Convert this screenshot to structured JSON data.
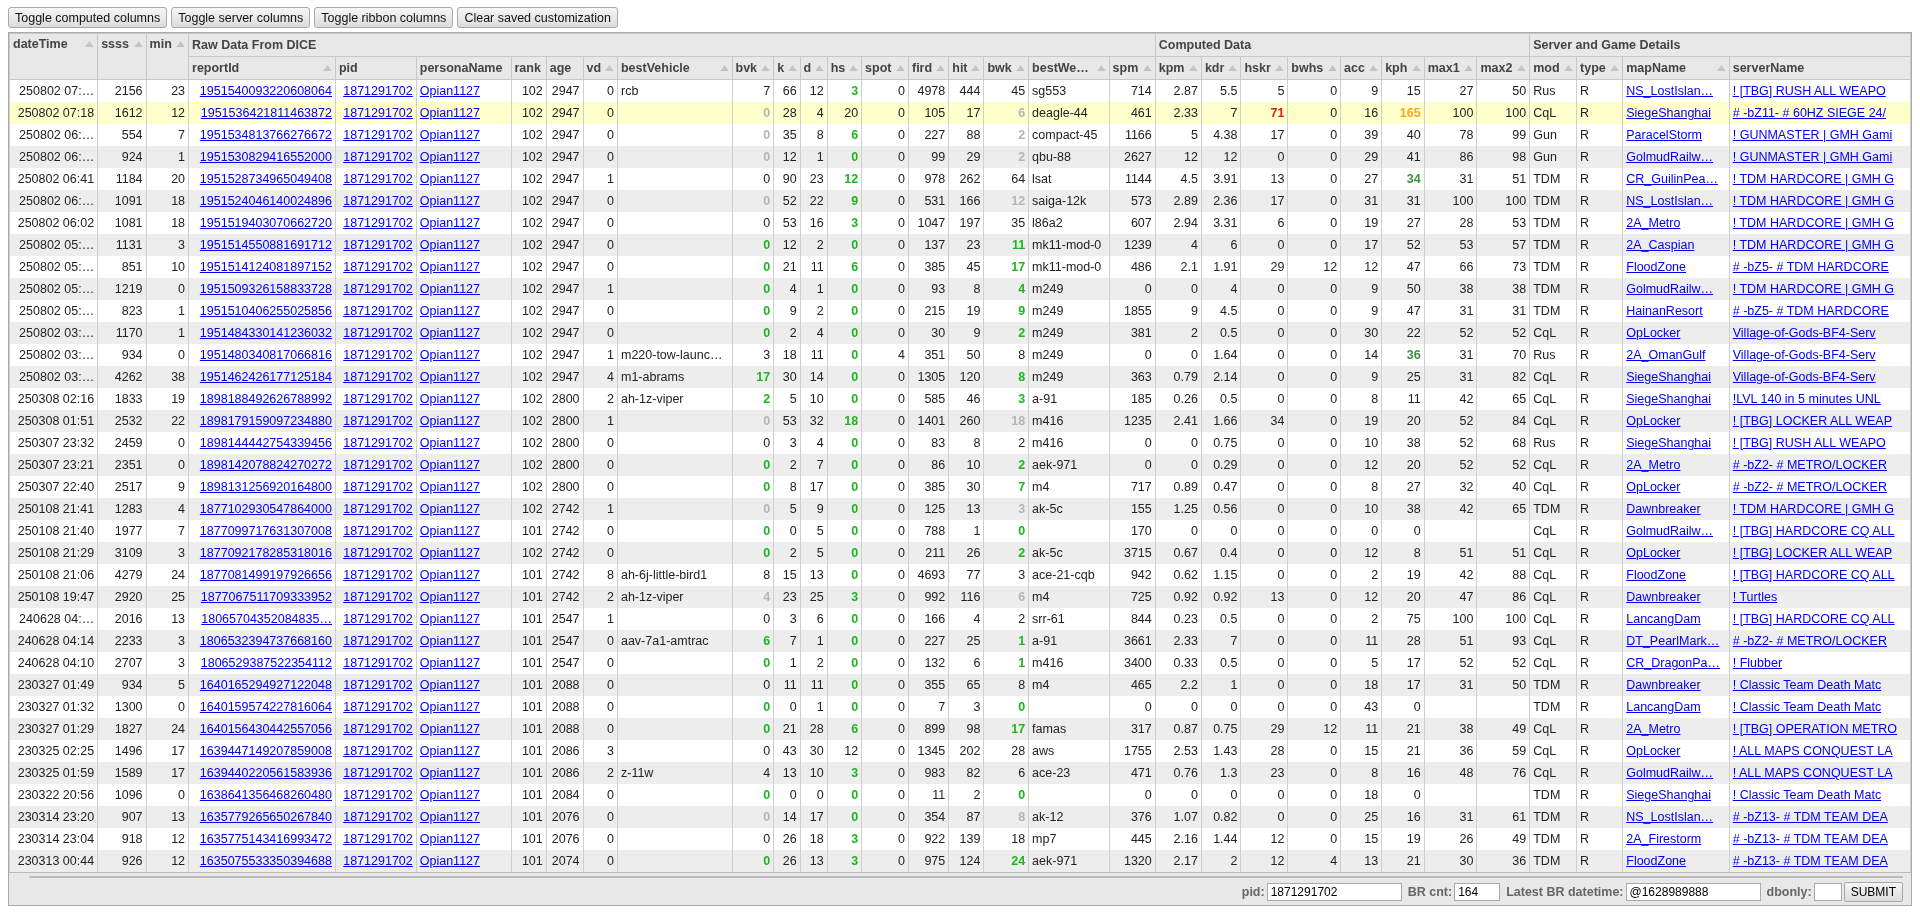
{
  "toolbar": {
    "buttons": [
      "Toggle computed columns",
      "Toggle server columns",
      "Toggle ribbon columns",
      "Clear saved customization"
    ]
  },
  "table": {
    "header": [
      {
        "label": "dateTime",
        "kind": "number",
        "sortable": true
      },
      {
        "label": "ssss",
        "kind": "number",
        "sortable": true
      },
      {
        "label": "min",
        "kind": "number",
        "sortable": true
      },
      {
        "kind": "group",
        "label": "Raw Data From DICE",
        "columns": [
          {
            "label": "reportId",
            "kind": "link-number",
            "sortable": true
          },
          {
            "label": "pid",
            "kind": "link-number",
            "sortable": false
          },
          {
            "label": "personaName",
            "kind": "link",
            "sortable": false
          },
          {
            "label": "rank",
            "kind": "number",
            "sortable": false
          },
          {
            "label": "age",
            "kind": "number",
            "sortable": false
          },
          {
            "label": "vd",
            "kind": "number",
            "sortable": true
          },
          {
            "label": "bestVehicle",
            "kind": "text",
            "sortable": true
          },
          {
            "label": "bvk",
            "kind": "number",
            "sortable": true
          },
          {
            "label": "k",
            "kind": "number",
            "sortable": true
          },
          {
            "label": "d",
            "kind": "number",
            "sortable": true
          },
          {
            "label": "hs",
            "kind": "number",
            "sortable": true
          },
          {
            "label": "spot",
            "kind": "number",
            "sortable": true
          },
          {
            "label": "fird",
            "kind": "number",
            "sortable": true
          },
          {
            "label": "hit",
            "kind": "number",
            "sortable": true
          },
          {
            "label": "bwk",
            "kind": "number",
            "sortable": true
          },
          {
            "label": "bestWe…",
            "kind": "text",
            "sortable": true
          },
          {
            "label": "spm",
            "kind": "number",
            "sortable": true
          }
        ]
      },
      {
        "kind": "group",
        "label": "Computed Data",
        "columns": [
          {
            "label": "kpm",
            "kind": "number",
            "sortable": true
          },
          {
            "label": "kdr",
            "kind": "number",
            "sortable": true
          },
          {
            "label": "hskr",
            "kind": "number",
            "sortable": true
          },
          {
            "label": "bwhs",
            "kind": "number",
            "sortable": true
          },
          {
            "label": "acc",
            "kind": "number",
            "sortable": true
          },
          {
            "label": "kph",
            "kind": "number",
            "sortable": true
          },
          {
            "label": "max1",
            "kind": "number",
            "sortable": true
          },
          {
            "label": "max2",
            "kind": "number",
            "sortable": true
          }
        ]
      },
      {
        "kind": "group",
        "label": "Server and Game Details",
        "columns": [
          {
            "label": "mod",
            "kind": "text",
            "sortable": true
          },
          {
            "label": "type",
            "kind": "text",
            "sortable": true
          },
          {
            "label": "mapName",
            "kind": "link",
            "sortable": true
          },
          {
            "label": "serverName",
            "kind": "link",
            "sortable": false
          }
        ]
      }
    ],
    "rows": [
      {
        "selected": false,
        "cells": [
          "250802 07:…",
          "2156",
          "23",
          "1951540093220608064",
          "1871291702",
          "Opian1127",
          "102",
          "2947",
          "0",
          "rcb",
          "7",
          "66",
          "12",
          {
            "text": "3",
            "color": "#1fb51f"
          },
          "0",
          "4978",
          "444",
          "45",
          "sg553",
          "714",
          "2.87",
          "5.5",
          "5",
          "0",
          "9",
          "15",
          "27",
          "50",
          "Rus",
          "R",
          "NS_LostIslan…",
          "! [TBG] RUSH ALL WEAPO"
        ]
      },
      {
        "selected": true,
        "cells": [
          "250802 07:18",
          "1612",
          "12",
          "1951536421811463872",
          "1871291702",
          "Opian1127",
          "102",
          "2947",
          "0",
          null,
          {
            "text": "0",
            "color": "#b4b4b4"
          },
          "28",
          "4",
          "20",
          "0",
          "105",
          "17",
          {
            "text": "6",
            "color": "#b4b4b4"
          },
          "deagle-44",
          "461",
          "2.33",
          "7",
          {
            "text": "71",
            "color": "#e01b1b"
          },
          "0",
          "16",
          {
            "text": "165",
            "color": "#f5a623"
          },
          "100",
          "100",
          "CqL",
          "R",
          "SiegeShanghai",
          "# -bZ11- # 60HZ SIEGE 24/"
        ]
      },
      {
        "selected": false,
        "cells": [
          "250802 06:…",
          "554",
          "7",
          "1951534813766276672",
          "1871291702",
          "Opian1127",
          "102",
          "2947",
          "0",
          null,
          {
            "text": "0",
            "color": "#b4b4b4"
          },
          "35",
          "8",
          {
            "text": "6",
            "color": "#1fb51f"
          },
          "0",
          "227",
          "88",
          {
            "text": "2",
            "color": "#b4b4b4"
          },
          "compact-45",
          "1166",
          "5",
          "4.38",
          "17",
          "0",
          "39",
          "40",
          "78",
          "99",
          "Gun",
          "R",
          "ParacelStorm",
          "! GUNMASTER | GMH Gami"
        ]
      },
      {
        "selected": false,
        "cells": [
          "250802 06:…",
          "924",
          "1",
          "1951530829416552000",
          "1871291702",
          "Opian1127",
          "102",
          "2947",
          "0",
          null,
          {
            "text": "0",
            "color": "#b4b4b4"
          },
          "12",
          "1",
          {
            "text": "0",
            "color": "#1fb51f"
          },
          "0",
          "99",
          "29",
          {
            "text": "2",
            "color": "#b4b4b4"
          },
          "qbu-88",
          "2627",
          "12",
          "12",
          "0",
          "0",
          "29",
          "41",
          "86",
          "98",
          "Gun",
          "R",
          "GolmudRailw…",
          "! GUNMASTER | GMH Gami"
        ]
      },
      {
        "selected": false,
        "cells": [
          "250802 06:41",
          "1184",
          "20",
          "1951528734965049408",
          "1871291702",
          "Opian1127",
          "102",
          "2947",
          "1",
          null,
          "0",
          "90",
          "23",
          {
            "text": "12",
            "color": "#1fb51f"
          },
          "0",
          "978",
          "262",
          "64",
          "lsat",
          "1144",
          "4.5",
          "3.91",
          "13",
          "0",
          "27",
          {
            "text": "34",
            "color": "#3f8f3f"
          },
          "31",
          "51",
          "TDM",
          "R",
          "CR_GuilinPea…",
          "! TDM HARDCORE | GMH G"
        ]
      },
      {
        "selected": false,
        "cells": [
          "250802 06:…",
          "1091",
          "18",
          "1951524046140024896",
          "1871291702",
          "Opian1127",
          "102",
          "2947",
          "0",
          null,
          {
            "text": "0",
            "color": "#b4b4b4"
          },
          "52",
          "22",
          {
            "text": "9",
            "color": "#1fb51f"
          },
          "0",
          "531",
          "166",
          {
            "text": "12",
            "color": "#b4b4b4"
          },
          "saiga-12k",
          "573",
          "2.89",
          "2.36",
          "17",
          "0",
          "31",
          "31",
          "100",
          "100",
          "TDM",
          "R",
          "NS_LostIslan…",
          "! TDM HARDCORE | GMH G"
        ]
      },
      {
        "selected": false,
        "cells": [
          "250802 06:02",
          "1081",
          "18",
          "1951519403070662720",
          "1871291702",
          "Opian1127",
          "102",
          "2947",
          "0",
          null,
          "0",
          "53",
          "16",
          {
            "text": "3",
            "color": "#1fb51f"
          },
          "0",
          "1047",
          "197",
          "35",
          "l86a2",
          "607",
          "2.94",
          "3.31",
          "6",
          "0",
          "19",
          "27",
          "28",
          "53",
          "TDM",
          "R",
          "2A_Metro",
          "! TDM HARDCORE | GMH G"
        ]
      },
      {
        "selected": false,
        "cells": [
          "250802 05:…",
          "1131",
          "3",
          "1951514550881691712",
          "1871291702",
          "Opian1127",
          "102",
          "2947",
          "0",
          null,
          {
            "text": "0",
            "color": "#1fb51f"
          },
          "12",
          "2",
          {
            "text": "0",
            "color": "#1fb51f"
          },
          "0",
          "137",
          "23",
          {
            "text": "11",
            "color": "#1fb51f"
          },
          "mk11-mod-0",
          "1239",
          "4",
          "6",
          "0",
          "0",
          "17",
          "52",
          "53",
          "57",
          "TDM",
          "R",
          "2A_Caspian",
          "! TDM HARDCORE | GMH G"
        ]
      },
      {
        "selected": false,
        "cells": [
          "250802 05:…",
          "851",
          "10",
          "1951514124081897152",
          "1871291702",
          "Opian1127",
          "102",
          "2947",
          "0",
          null,
          {
            "text": "0",
            "color": "#1fb51f"
          },
          "21",
          "11",
          {
            "text": "6",
            "color": "#1fb51f"
          },
          "0",
          "385",
          "45",
          {
            "text": "17",
            "color": "#1fb51f"
          },
          "mk11-mod-0",
          "486",
          "2.1",
          "1.91",
          "29",
          "12",
          "12",
          "47",
          "66",
          "73",
          "TDM",
          "R",
          "FloodZone",
          "# -bZ5- # TDM HARDCORE"
        ]
      },
      {
        "selected": false,
        "cells": [
          "250802 05:…",
          "1219",
          "0",
          "1951509326158833728",
          "1871291702",
          "Opian1127",
          "102",
          "2947",
          "1",
          null,
          {
            "text": "0",
            "color": "#1fb51f"
          },
          "4",
          "1",
          {
            "text": "0",
            "color": "#1fb51f"
          },
          "0",
          "93",
          "8",
          {
            "text": "4",
            "color": "#1fb51f"
          },
          "m249",
          "0",
          "0",
          "4",
          "0",
          "0",
          "9",
          "50",
          "38",
          "38",
          "TDM",
          "R",
          "GolmudRailw…",
          "! TDM HARDCORE | GMH G"
        ]
      },
      {
        "selected": false,
        "cells": [
          "250802 05:…",
          "823",
          "1",
          "1951510406255025856",
          "1871291702",
          "Opian1127",
          "102",
          "2947",
          "0",
          null,
          {
            "text": "0",
            "color": "#1fb51f"
          },
          "9",
          "2",
          {
            "text": "0",
            "color": "#1fb51f"
          },
          "0",
          "215",
          "19",
          {
            "text": "9",
            "color": "#1fb51f"
          },
          "m249",
          "1855",
          "9",
          "4.5",
          "0",
          "0",
          "9",
          "47",
          "31",
          "31",
          "TDM",
          "R",
          "HainanResort",
          "# -bZ5- # TDM HARDCORE"
        ]
      },
      {
        "selected": false,
        "cells": [
          "250802 03:…",
          "1170",
          "1",
          "1951484330141236032",
          "1871291702",
          "Opian1127",
          "102",
          "2947",
          "0",
          null,
          {
            "text": "0",
            "color": "#1fb51f"
          },
          "2",
          "4",
          {
            "text": "0",
            "color": "#1fb51f"
          },
          "0",
          "30",
          "9",
          {
            "text": "2",
            "color": "#1fb51f"
          },
          "m249",
          "381",
          "2",
          "0.5",
          "0",
          "0",
          "30",
          "22",
          "52",
          "52",
          "CqL",
          "R",
          "OpLocker",
          "Village-of-Gods-BF4-Serv"
        ]
      },
      {
        "selected": false,
        "cells": [
          "250802 03:…",
          "934",
          "0",
          "1951480340817066816",
          "1871291702",
          "Opian1127",
          "102",
          "2947",
          "1",
          "m220-tow-launc…",
          "3",
          "18",
          "11",
          {
            "text": "0",
            "color": "#1fb51f"
          },
          "4",
          "351",
          "50",
          "8",
          "m249",
          "0",
          "0",
          "1.64",
          "0",
          "0",
          "14",
          {
            "text": "36",
            "color": "#3f8f3f"
          },
          "31",
          "70",
          "Rus",
          "R",
          "2A_OmanGulf",
          "Village-of-Gods-BF4-Serv"
        ]
      },
      {
        "selected": false,
        "cells": [
          "250802 03:…",
          "4262",
          "38",
          "1951462426177125184",
          "1871291702",
          "Opian1127",
          "102",
          "2947",
          "4",
          "m1-abrams",
          {
            "text": "17",
            "color": "#1fb51f"
          },
          "30",
          "14",
          {
            "text": "0",
            "color": "#1fb51f"
          },
          "0",
          "1305",
          "120",
          {
            "text": "8",
            "color": "#1fb51f"
          },
          "m249",
          "363",
          "0.79",
          "2.14",
          "0",
          "0",
          "9",
          "25",
          "31",
          "82",
          "CqL",
          "R",
          "SiegeShanghai",
          "Village-of-Gods-BF4-Serv"
        ]
      },
      {
        "selected": false,
        "cells": [
          "250308 02:16",
          "1833",
          "19",
          "1898188492626788992",
          "1871291702",
          "Opian1127",
          "102",
          "2800",
          "2",
          "ah-1z-viper",
          {
            "text": "2",
            "color": "#1fb51f"
          },
          "5",
          "10",
          {
            "text": "0",
            "color": "#1fb51f"
          },
          "0",
          "585",
          "46",
          {
            "text": "3",
            "color": "#1fb51f"
          },
          "a-91",
          "185",
          "0.26",
          "0.5",
          "0",
          "0",
          "8",
          "11",
          "42",
          "65",
          "CqL",
          "R",
          "SiegeShanghai",
          "!LVL 140 in 5 minutes UNL"
        ]
      },
      {
        "selected": false,
        "cells": [
          "250308 01:51",
          "2532",
          "22",
          "1898179159097234880",
          "1871291702",
          "Opian1127",
          "102",
          "2800",
          "1",
          null,
          {
            "text": "0",
            "color": "#b4b4b4"
          },
          "53",
          "32",
          {
            "text": "18",
            "color": "#1fb51f"
          },
          "0",
          "1401",
          "260",
          {
            "text": "18",
            "color": "#b4b4b4"
          },
          "m416",
          "1235",
          "2.41",
          "1.66",
          "34",
          "0",
          "19",
          "20",
          "52",
          "84",
          "CqL",
          "R",
          "OpLocker",
          "! [TBG] LOCKER ALL WEAP"
        ]
      },
      {
        "selected": false,
        "cells": [
          "250307 23:32",
          "2459",
          "0",
          "1898144442754339456",
          "1871291702",
          "Opian1127",
          "102",
          "2800",
          "0",
          null,
          "0",
          "3",
          "4",
          {
            "text": "0",
            "color": "#1fb51f"
          },
          "0",
          "83",
          "8",
          "2",
          "m416",
          "0",
          "0",
          "0.75",
          "0",
          "0",
          "10",
          "38",
          "52",
          "68",
          "Rus",
          "R",
          "SiegeShanghai",
          "! [TBG] RUSH ALL WEAPO"
        ]
      },
      {
        "selected": false,
        "cells": [
          "250307 23:21",
          "2351",
          "0",
          "1898142078824270272",
          "1871291702",
          "Opian1127",
          "102",
          "2800",
          "0",
          null,
          {
            "text": "0",
            "color": "#1fb51f"
          },
          "2",
          "7",
          {
            "text": "0",
            "color": "#1fb51f"
          },
          "0",
          "86",
          "10",
          {
            "text": "2",
            "color": "#1fb51f"
          },
          "aek-971",
          "0",
          "0",
          "0.29",
          "0",
          "0",
          "12",
          "20",
          "52",
          "52",
          "CqL",
          "R",
          "2A_Metro",
          "# -bZ2- # METRO/LOCKER"
        ]
      },
      {
        "selected": false,
        "cells": [
          "250307 22:40",
          "2517",
          "9",
          "1898131256920164800",
          "1871291702",
          "Opian1127",
          "102",
          "2800",
          "0",
          null,
          {
            "text": "0",
            "color": "#1fb51f"
          },
          "8",
          "17",
          {
            "text": "0",
            "color": "#1fb51f"
          },
          "0",
          "385",
          "30",
          {
            "text": "7",
            "color": "#1fb51f"
          },
          "m4",
          "717",
          "0.89",
          "0.47",
          "0",
          "0",
          "8",
          "27",
          "32",
          "40",
          "CqL",
          "R",
          "OpLocker",
          "# -bZ2- # METRO/LOCKER"
        ]
      },
      {
        "selected": false,
        "cells": [
          "250108 21:41",
          "1283",
          "4",
          "1877102930547864000",
          "1871291702",
          "Opian1127",
          "102",
          "2742",
          "1",
          null,
          {
            "text": "0",
            "color": "#b4b4b4"
          },
          "5",
          "9",
          {
            "text": "0",
            "color": "#1fb51f"
          },
          "0",
          "125",
          "13",
          {
            "text": "3",
            "color": "#b4b4b4"
          },
          "ak-5c",
          "155",
          "1.25",
          "0.56",
          "0",
          "0",
          "10",
          "38",
          "42",
          "65",
          "TDM",
          "R",
          "Dawnbreaker",
          "! TDM HARDCORE | GMH G"
        ]
      },
      {
        "selected": false,
        "cells": [
          "250108 21:40",
          "1977",
          "7",
          "1877099717631307008",
          "1871291702",
          "Opian1127",
          "101",
          "2742",
          "0",
          null,
          {
            "text": "0",
            "color": "#1fb51f"
          },
          "0",
          "5",
          {
            "text": "0",
            "color": "#1fb51f"
          },
          "0",
          "788",
          "1",
          {
            "text": "0",
            "color": "#1fb51f"
          },
          null,
          "170",
          "0",
          "0",
          "0",
          "0",
          "0",
          "0",
          null,
          null,
          "CqL",
          "R",
          "GolmudRailw…",
          "! [TBG] HARDCORE CQ ALL"
        ]
      },
      {
        "selected": false,
        "cells": [
          "250108 21:29",
          "3109",
          "3",
          "1877092178285318016",
          "1871291702",
          "Opian1127",
          "102",
          "2742",
          "0",
          null,
          {
            "text": "0",
            "color": "#1fb51f"
          },
          "2",
          "5",
          {
            "text": "0",
            "color": "#1fb51f"
          },
          "0",
          "211",
          "26",
          {
            "text": "2",
            "color": "#1fb51f"
          },
          "ak-5c",
          "3715",
          "0.67",
          "0.4",
          "0",
          "0",
          "12",
          "8",
          "51",
          "51",
          "CqL",
          "R",
          "OpLocker",
          "! [TBG] LOCKER ALL WEAP"
        ]
      },
      {
        "selected": false,
        "cells": [
          "250108 21:06",
          "4279",
          "24",
          "1877081499197926656",
          "1871291702",
          "Opian1127",
          "101",
          "2742",
          "8",
          "ah-6j-little-bird1",
          "8",
          "15",
          "13",
          {
            "text": "0",
            "color": "#1fb51f"
          },
          "0",
          "4693",
          "77",
          "3",
          "ace-21-cqb",
          "942",
          "0.62",
          "1.15",
          "0",
          "0",
          "2",
          "19",
          "42",
          "88",
          "CqL",
          "R",
          "FloodZone",
          "! [TBG] HARDCORE CQ ALL"
        ]
      },
      {
        "selected": false,
        "cells": [
          "250108 19:47",
          "2920",
          "25",
          "1877067511709333952",
          "1871291702",
          "Opian1127",
          "101",
          "2742",
          "2",
          "ah-1z-viper",
          {
            "text": "4",
            "color": "#b4b4b4"
          },
          "23",
          "25",
          {
            "text": "3",
            "color": "#1fb51f"
          },
          "0",
          "992",
          "116",
          {
            "text": "6",
            "color": "#b4b4b4"
          },
          "m4",
          "725",
          "0.92",
          "0.92",
          "13",
          "0",
          "12",
          "20",
          "47",
          "86",
          "CqL",
          "R",
          "Dawnbreaker",
          "! Turtles"
        ]
      },
      {
        "selected": false,
        "cells": [
          "240628 04:…",
          "2016",
          "13",
          "18065704352084835…",
          "1871291702",
          "Opian1127",
          "101",
          "2547",
          "1",
          null,
          "0",
          "3",
          "6",
          {
            "text": "0",
            "color": "#1fb51f"
          },
          "0",
          "166",
          "4",
          "2",
          "srr-61",
          "844",
          "0.23",
          "0.5",
          "0",
          "0",
          "2",
          "75",
          "100",
          "100",
          "CqL",
          "R",
          "LancangDam",
          "! [TBG] HARDCORE CQ ALL"
        ]
      },
      {
        "selected": false,
        "cells": [
          "240628 04:14",
          "2233",
          "3",
          "1806532394737668160",
          "1871291702",
          "Opian1127",
          "101",
          "2547",
          "0",
          "aav-7a1-amtrac",
          {
            "text": "6",
            "color": "#1fb51f"
          },
          "7",
          "1",
          {
            "text": "0",
            "color": "#1fb51f"
          },
          "0",
          "227",
          "25",
          {
            "text": "1",
            "color": "#1fb51f"
          },
          "a-91",
          "3661",
          "2.33",
          "7",
          "0",
          "0",
          "11",
          "28",
          "51",
          "93",
          "CqL",
          "R",
          "DT_PearlMark…",
          "# -bZ2- # METRO/LOCKER"
        ]
      },
      {
        "selected": false,
        "cells": [
          "240628 04:10",
          "2707",
          "3",
          "1806529387522354112",
          "1871291702",
          "Opian1127",
          "101",
          "2547",
          "0",
          null,
          {
            "text": "0",
            "color": "#1fb51f"
          },
          "1",
          "2",
          {
            "text": "0",
            "color": "#1fb51f"
          },
          "0",
          "132",
          "6",
          {
            "text": "1",
            "color": "#1fb51f"
          },
          "m416",
          "3400",
          "0.33",
          "0.5",
          "0",
          "0",
          "5",
          "17",
          "52",
          "52",
          "CqL",
          "R",
          "CR_DragonPa…",
          "! Flubber"
        ]
      },
      {
        "selected": false,
        "cells": [
          "230327 01:49",
          "934",
          "5",
          "1640165294927122048",
          "1871291702",
          "Opian1127",
          "101",
          "2088",
          "0",
          null,
          "0",
          "11",
          "11",
          {
            "text": "0",
            "color": "#1fb51f"
          },
          "0",
          "355",
          "65",
          "8",
          "m4",
          "465",
          "2.2",
          "1",
          "0",
          "0",
          "18",
          "17",
          "31",
          "50",
          "TDM",
          "R",
          "Dawnbreaker",
          "! Classic Team Death Matc"
        ]
      },
      {
        "selected": false,
        "cells": [
          "230327 01:32",
          "1300",
          "0",
          "1640159574227816064",
          "1871291702",
          "Opian1127",
          "101",
          "2088",
          "0",
          null,
          {
            "text": "0",
            "color": "#1fb51f"
          },
          "0",
          "1",
          {
            "text": "0",
            "color": "#1fb51f"
          },
          "0",
          "7",
          "3",
          {
            "text": "0",
            "color": "#1fb51f"
          },
          null,
          "0",
          "0",
          "0",
          "0",
          "0",
          "43",
          "0",
          null,
          null,
          "TDM",
          "R",
          "LancangDam",
          "! Classic Team Death Matc"
        ]
      },
      {
        "selected": false,
        "cells": [
          "230327 01:29",
          "1827",
          "24",
          "1640156430442557056",
          "1871291702",
          "Opian1127",
          "101",
          "2088",
          "0",
          null,
          {
            "text": "0",
            "color": "#1fb51f"
          },
          "21",
          "28",
          {
            "text": "6",
            "color": "#1fb51f"
          },
          "0",
          "899",
          "98",
          {
            "text": "17",
            "color": "#1fb51f"
          },
          "famas",
          "317",
          "0.87",
          "0.75",
          "29",
          "12",
          "11",
          "21",
          "38",
          "49",
          "CqL",
          "R",
          "2A_Metro",
          "! [TBG] OPERATION METRO"
        ]
      },
      {
        "selected": false,
        "cells": [
          "230325 02:25",
          "1496",
          "17",
          "1639447149207859008",
          "1871291702",
          "Opian1127",
          "101",
          "2086",
          "3",
          null,
          "0",
          "43",
          "30",
          "12",
          "0",
          "1345",
          "202",
          "28",
          "aws",
          "1755",
          "2.53",
          "1.43",
          "28",
          "0",
          "15",
          "21",
          "36",
          "59",
          "CqL",
          "R",
          "OpLocker",
          "! ALL MAPS CONQUEST LA"
        ]
      },
      {
        "selected": false,
        "cells": [
          "230325 01:59",
          "1589",
          "17",
          "1639440220561583936",
          "1871291702",
          "Opian1127",
          "101",
          "2086",
          "2",
          "z-11w",
          "4",
          "13",
          "10",
          {
            "text": "3",
            "color": "#1fb51f"
          },
          "0",
          "983",
          "82",
          "6",
          "ace-23",
          "471",
          "0.76",
          "1.3",
          "23",
          "0",
          "8",
          "16",
          "48",
          "76",
          "CqL",
          "R",
          "GolmudRailw…",
          "! ALL MAPS CONQUEST LA"
        ]
      },
      {
        "selected": false,
        "cells": [
          "230322 20:56",
          "1096",
          "0",
          "1638641356468260480",
          "1871291702",
          "Opian1127",
          "101",
          "2084",
          "0",
          null,
          {
            "text": "0",
            "color": "#1fb51f"
          },
          "0",
          "0",
          {
            "text": "0",
            "color": "#1fb51f"
          },
          "0",
          "11",
          "2",
          {
            "text": "0",
            "color": "#1fb51f"
          },
          null,
          "0",
          "0",
          "0",
          "0",
          "0",
          "18",
          "0",
          null,
          null,
          "TDM",
          "R",
          "SiegeShanghai",
          "! Classic Team Death Matc"
        ]
      },
      {
        "selected": false,
        "cells": [
          "230314 23:20",
          "907",
          "13",
          "1635779265650267840",
          "1871291702",
          "Opian1127",
          "101",
          "2076",
          "0",
          null,
          {
            "text": "0",
            "color": "#b4b4b4"
          },
          "14",
          "17",
          {
            "text": "0",
            "color": "#1fb51f"
          },
          "0",
          "354",
          "87",
          {
            "text": "8",
            "color": "#b4b4b4"
          },
          "ak-12",
          "376",
          "1.07",
          "0.82",
          "0",
          "0",
          "25",
          "16",
          "31",
          "61",
          "TDM",
          "R",
          "NS_LostIslan…",
          "# -bZ13- # TDM TEAM DEA"
        ]
      },
      {
        "selected": false,
        "cells": [
          "230314 23:04",
          "918",
          "12",
          "1635775143416993472",
          "1871291702",
          "Opian1127",
          "101",
          "2076",
          "0",
          null,
          "0",
          "26",
          "18",
          {
            "text": "3",
            "color": "#1fb51f"
          },
          "0",
          "922",
          "139",
          "18",
          "mp7",
          "445",
          "2.16",
          "1.44",
          "12",
          "0",
          "15",
          "19",
          "26",
          "49",
          "TDM",
          "R",
          "2A_Firestorm",
          "# -bZ13- # TDM TEAM DEA"
        ]
      },
      {
        "selected": false,
        "cells": [
          "230313 00:44",
          "926",
          "12",
          "1635075533350394688",
          "1871291702",
          "Opian1127",
          "101",
          "2074",
          "0",
          null,
          {
            "text": "0",
            "color": "#1fb51f"
          },
          "26",
          "13",
          {
            "text": "3",
            "color": "#1fb51f"
          },
          "0",
          "975",
          "124",
          {
            "text": "24",
            "color": "#1fb51f"
          },
          "aek-971",
          "1320",
          "2.17",
          "2",
          "12",
          "4",
          "13",
          "21",
          "30",
          "36",
          "TDM",
          "R",
          "FloodZone",
          "# -bZ13- # TDM TEAM DEA"
        ]
      }
    ]
  },
  "form": {
    "fields": [
      {
        "label": "pid:",
        "value": "1871291702"
      },
      {
        "label": "BR cnt:",
        "value": "164"
      },
      {
        "label": "Latest BR datetime:",
        "value": "@1628989888"
      },
      {
        "label": "dbonly:"
      }
    ],
    "submit": "SUBMIT"
  }
}
